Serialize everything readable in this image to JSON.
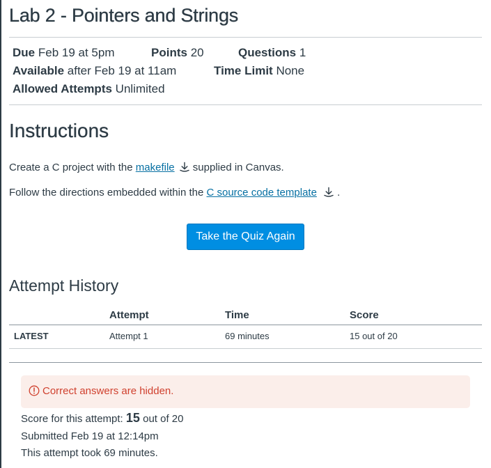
{
  "quiz": {
    "title": "Lab 2 - Pointers and Strings"
  },
  "details": {
    "due_label": "Due",
    "due_value": "Feb 19 at 5pm",
    "points_label": "Points",
    "points_value": "20",
    "questions_label": "Questions",
    "questions_value": "1",
    "available_label": "Available",
    "available_value": "after Feb 19 at 11am",
    "time_limit_label": "Time Limit",
    "time_limit_value": "None",
    "attempts_label": "Allowed Attempts",
    "attempts_value": "Unlimited"
  },
  "instructions": {
    "heading": "Instructions",
    "line1_before": "Create a C project with the ",
    "line1_link": "makefile",
    "line1_after": " supplied in Canvas.",
    "line2_before": "Follow the directions embedded within the ",
    "line2_link": "C source code template",
    "line2_after": " ."
  },
  "actions": {
    "take_again_label": "Take the Quiz Again"
  },
  "attempt_history": {
    "heading": "Attempt History",
    "columns": [
      "Attempt",
      "Time",
      "Score"
    ],
    "rows": [
      {
        "tag": "LATEST",
        "attempt": "Attempt 1",
        "time": "69 minutes",
        "score": "15 out of 20"
      }
    ]
  },
  "result": {
    "alert": "Correct answers are hidden.",
    "score_prefix": "Score for this attempt: ",
    "score_value": "15",
    "score_suffix": " out of 20",
    "submitted": "Submitted Feb 19 at 12:14pm",
    "duration": "This attempt took 69 minutes."
  },
  "colors": {
    "text": "#2d3b45",
    "link": "#0770a3",
    "button": "#008ee2",
    "alert_bg": "#fbeeea",
    "alert_text": "#d0412f",
    "rule": "#c7cdd1"
  },
  "icons": {
    "download": "download-icon",
    "warning": "warning-circle-icon"
  }
}
